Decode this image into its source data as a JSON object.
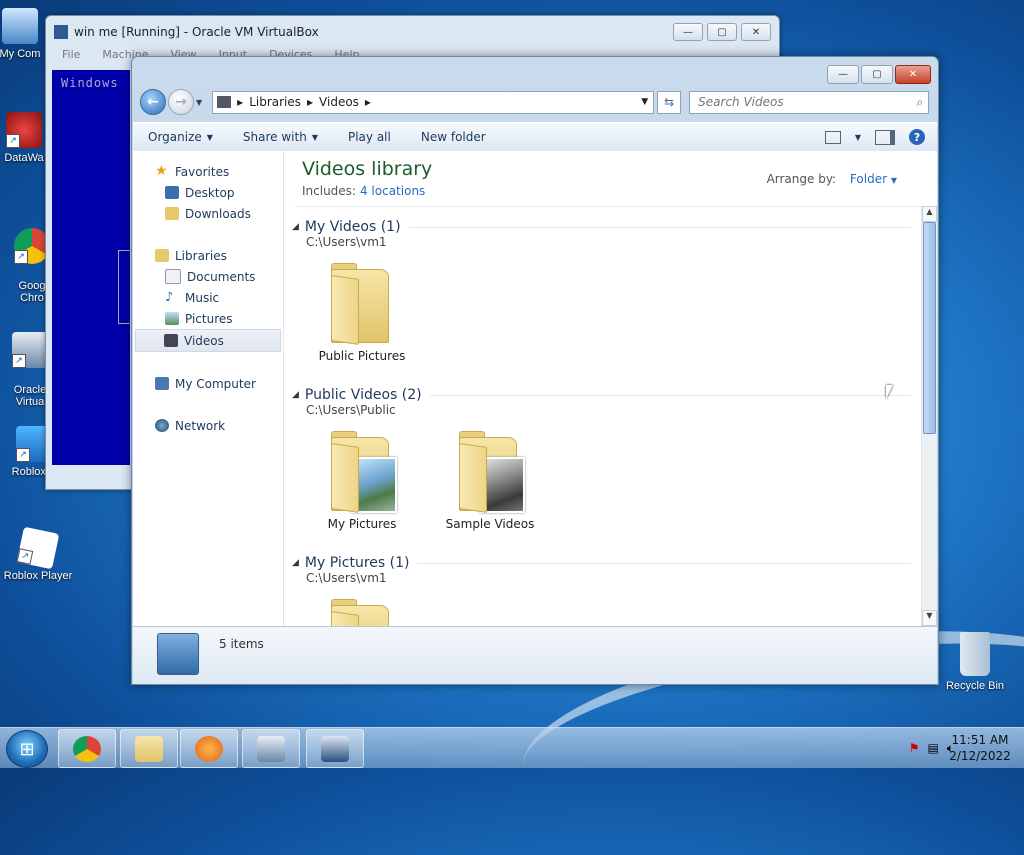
{
  "desktop": {
    "icons": [
      {
        "label": "My Com"
      },
      {
        "label": "DataWa"
      },
      {
        "label": "Goog\nChro"
      },
      {
        "label": "Oracle\nVirtua"
      },
      {
        "label": "Roblox S"
      },
      {
        "label": "Roblox Player"
      },
      {
        "label": "Recycle Bin"
      }
    ]
  },
  "vbox": {
    "title": "win me [Running] - Oracle VM VirtualBox",
    "menu": [
      "File",
      "Machine",
      "View",
      "Input",
      "Devices",
      "Help"
    ],
    "guest_title": "Windows"
  },
  "explorer": {
    "breadcrumb": [
      "Libraries",
      "Videos"
    ],
    "search_placeholder": "Search Videos",
    "toolbar": {
      "organize": "Organize",
      "share_with": "Share with",
      "play_all": "Play all",
      "new_folder": "New folder"
    },
    "nav": {
      "favorites": "Favorites",
      "desktop": "Desktop",
      "downloads": "Downloads",
      "libraries": "Libraries",
      "documents": "Documents",
      "music": "Music",
      "pictures": "Pictures",
      "videos": "Videos",
      "my_computer": "My Computer",
      "network": "Network"
    },
    "library": {
      "title": "Videos library",
      "includes_label": "Includes:",
      "locations": "4 locations",
      "arrange_label": "Arrange by:",
      "arrange_value": "Folder"
    },
    "groups": [
      {
        "heading": "My Videos (1)",
        "path": "C:\\Users\\vm1",
        "items": [
          "Public Pictures"
        ]
      },
      {
        "heading": "Public Videos (2)",
        "path": "C:\\Users\\Public",
        "items": [
          "My Pictures",
          "Sample Videos"
        ]
      },
      {
        "heading": "My Pictures (1)",
        "path": "C:\\Users\\vm1",
        "items": []
      }
    ],
    "status": "5 items"
  },
  "taskbar": {
    "clock_time": "11:51 AM",
    "clock_date": "2/12/2022"
  }
}
